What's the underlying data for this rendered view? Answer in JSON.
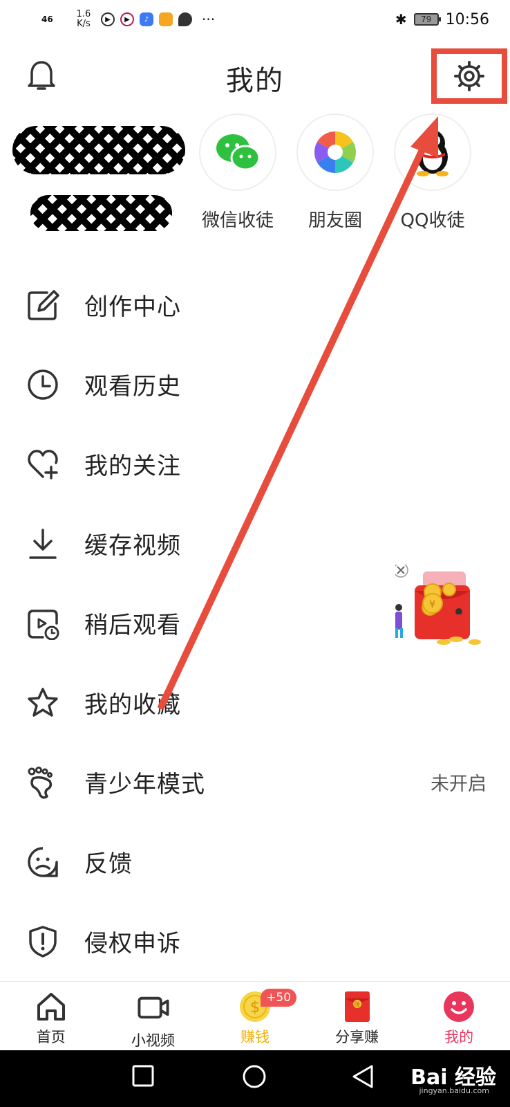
{
  "status_bar": {
    "network": "46",
    "speed": "1.6\nK/s",
    "battery": "79",
    "time": "10:56"
  },
  "header": {
    "title": "我的"
  },
  "share": [
    {
      "label": "微信收徒",
      "icon": "wechat-icon"
    },
    {
      "label": "朋友圈",
      "icon": "moments-icon"
    },
    {
      "label": "QQ收徒",
      "icon": "qq-icon"
    }
  ],
  "menu": [
    {
      "label": "创作中心",
      "icon": "edit-icon"
    },
    {
      "label": "观看历史",
      "icon": "clock-icon"
    },
    {
      "label": "我的关注",
      "icon": "heart-plus-icon"
    },
    {
      "label": "缓存视频",
      "icon": "download-icon"
    },
    {
      "label": "稍后观看",
      "icon": "watch-later-icon"
    },
    {
      "label": "我的收藏",
      "icon": "star-icon"
    },
    {
      "label": "青少年模式",
      "icon": "footprint-icon",
      "value": "未开启"
    },
    {
      "label": "反馈",
      "icon": "sad-face-icon"
    },
    {
      "label": "侵权申诉",
      "icon": "shield-alert-icon"
    }
  ],
  "tabs": [
    {
      "label": "首页",
      "icon": "home-icon"
    },
    {
      "label": "小视频",
      "icon": "video-icon"
    },
    {
      "label": "赚钱",
      "icon": "coin-icon",
      "badge": "+50"
    },
    {
      "label": "分享赚",
      "icon": "red-packet-icon",
      "packet_char": "赚"
    },
    {
      "label": "我的",
      "icon": "smile-icon"
    }
  ],
  "watermark": {
    "brand": "Bai 经验",
    "url": "jingyan.baidu.com"
  },
  "colors": {
    "highlight": "#e74c3c",
    "gold": "#f2b200",
    "pink": "#e8365d"
  }
}
